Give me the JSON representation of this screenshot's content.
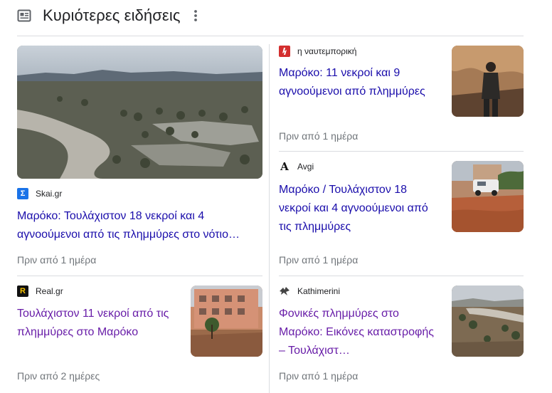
{
  "section": {
    "title": "Κυριότερες ειδήσεις"
  },
  "colors": {
    "link": "#1a0dab",
    "visited": "#681da8",
    "meta": "#70757a",
    "divider": "#dadce0"
  },
  "stories": {
    "main": {
      "source": "Skai.gr",
      "favicon": "skai-sigma-icon",
      "headline": "Μαρόκο: Τουλάχιστον 18 νεκροί και 4 αγνοούμενοι από τις πλημμύρες στο νότιο…",
      "time": "Πριν από 1 ημέρα"
    },
    "r1": {
      "source": "η ναυτεμπορική",
      "favicon": "naftemporiki-icon",
      "headline": "Μαρόκο: 11 νεκροί και 9 αγνοούμενοι από πλημμύρες",
      "time": "Πριν από 1 ημέρα"
    },
    "r2": {
      "source": "Avgi",
      "favicon": "avgi-a-icon",
      "favicon_glyph": "A",
      "headline": "Μαρόκο / Τουλάχιστον 18 νεκροί και 4 αγνοούμενοι από τις πλημμύρες",
      "time": "Πριν από 1 ημέρα"
    },
    "l2": {
      "source": "Real.gr",
      "favicon": "real-r-icon",
      "favicon_glyph": "R",
      "headline": "Τουλάχιστον 11 νεκροί από τις πλημμύρες στο Μαρόκο",
      "time": "Πριν από 2 ημέρες"
    },
    "r3": {
      "source": "Kathimerini",
      "favicon": "kathimerini-bird-icon",
      "headline": "Φονικές πλημμύρες στο Μαρόκο: Εικόνες καταστροφής – Τουλάχιστ…",
      "time": "Πριν από 1 ημέρα"
    }
  }
}
